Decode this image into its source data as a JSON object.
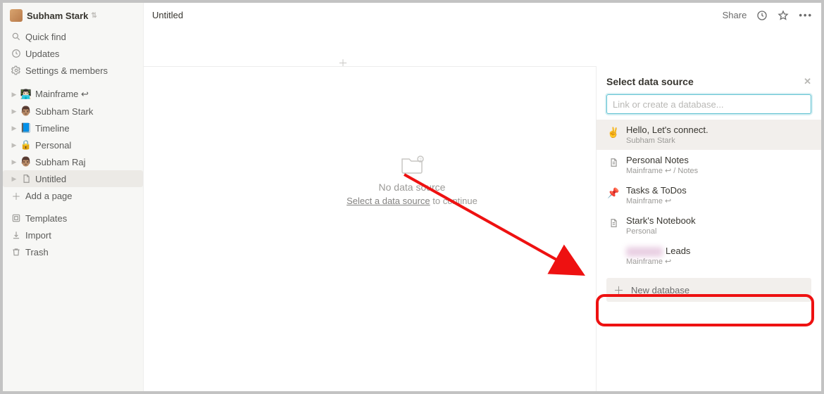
{
  "workspace": {
    "name": "Subham Stark"
  },
  "sidebar": {
    "quick_find": "Quick find",
    "updates": "Updates",
    "settings": "Settings & members",
    "pages": [
      {
        "icon": "👨🏻‍💻",
        "label": "Mainframe ↩"
      },
      {
        "icon": "👨🏽",
        "label": "Subham Stark"
      },
      {
        "icon": "📘",
        "label": "Timeline"
      },
      {
        "icon": "🔒",
        "label": "Personal"
      },
      {
        "icon": "👨🏽",
        "label": "Subham Raj"
      },
      {
        "icon": "📄",
        "label": "Untitled"
      }
    ],
    "add_page": "Add a page",
    "templates": "Templates",
    "import": "Import",
    "trash": "Trash"
  },
  "topbar": {
    "title": "Untitled",
    "share": "Share"
  },
  "empty": {
    "title": "No data source",
    "select_link": "Select a data source",
    "cont": " to continue"
  },
  "popover": {
    "title": "Select data source",
    "placeholder": "Link or create a database...",
    "items": [
      {
        "icon": "✌️",
        "title": "Hello, Let's connect.",
        "sub": "Subham Stark"
      },
      {
        "icon": "📄",
        "title": "Personal Notes",
        "sub": "Mainframe ↩ / Notes"
      },
      {
        "icon": "📌",
        "title": "Tasks & ToDos",
        "sub": "Mainframe ↩"
      },
      {
        "icon": "📄",
        "title": "Stark's Notebook",
        "sub": "Personal"
      },
      {
        "icon": "",
        "title": "Leads",
        "sub": "Mainframe ↩"
      }
    ],
    "new_db": "New database"
  }
}
